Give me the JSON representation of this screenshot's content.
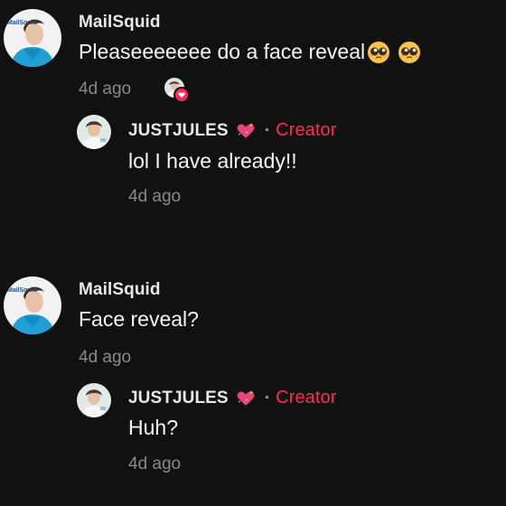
{
  "threads": [
    {
      "comment": {
        "username": "MailSquid",
        "avatar_text": "MailSquid",
        "text": "Pleaseeeeeee do a face reveal",
        "emojis": [
          "pleading-face-emoji",
          "pleading-face-emoji"
        ],
        "time": "4d ago",
        "creator_liked": true
      },
      "reply": {
        "username": "JUSTJULES",
        "badge_icon": "sparkling-heart-emoji",
        "separator": "·",
        "creator_label": "Creator",
        "text": "lol I have already!!",
        "time": "4d ago"
      }
    },
    {
      "comment": {
        "username": "MailSquid",
        "avatar_text": "MailSquid",
        "text": "Face reveal?",
        "emojis": [],
        "time": "4d ago",
        "creator_liked": false
      },
      "reply": {
        "username": "JUSTJULES",
        "badge_icon": "sparkling-heart-emoji",
        "separator": "·",
        "creator_label": "Creator",
        "text": "Huh?",
        "time": "4d ago"
      }
    }
  ],
  "colors": {
    "background": "#111111",
    "accent": "#fe2c55",
    "muted": "#8a8a8a"
  }
}
